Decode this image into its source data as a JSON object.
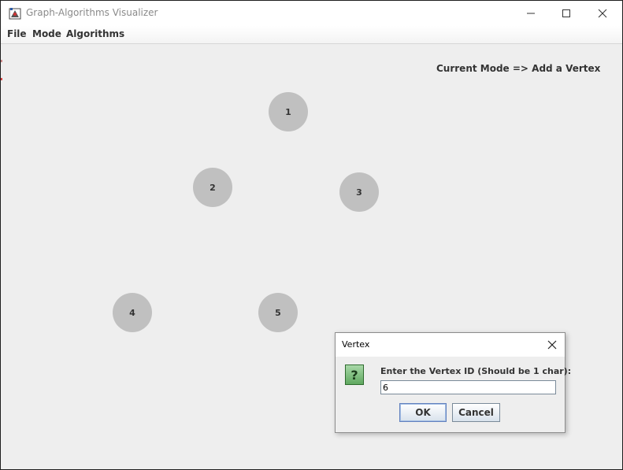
{
  "window": {
    "title": "Graph-Algorithms Visualizer"
  },
  "menu": {
    "items": [
      {
        "label": "File"
      },
      {
        "label": "Mode"
      },
      {
        "label": "Algorithms"
      }
    ]
  },
  "status": {
    "mode_label": "Current Mode => Add a Vertex"
  },
  "graph": {
    "vertices": [
      {
        "id": "1"
      },
      {
        "id": "2"
      },
      {
        "id": "3"
      },
      {
        "id": "4"
      },
      {
        "id": "5"
      }
    ]
  },
  "dialog": {
    "title": "Vertex",
    "prompt": "Enter the Vertex ID (Should be 1 char):",
    "input_value": "6",
    "ok_label": "OK",
    "cancel_label": "Cancel"
  },
  "colors": {
    "vertex_fill": "#c0c0c0",
    "background": "#eeeeee",
    "question_icon": "#5fa85f"
  },
  "icons": {
    "app": "app-icon",
    "minimize": "minimize-icon",
    "maximize": "maximize-icon",
    "close": "close-icon",
    "question": "question-icon"
  }
}
